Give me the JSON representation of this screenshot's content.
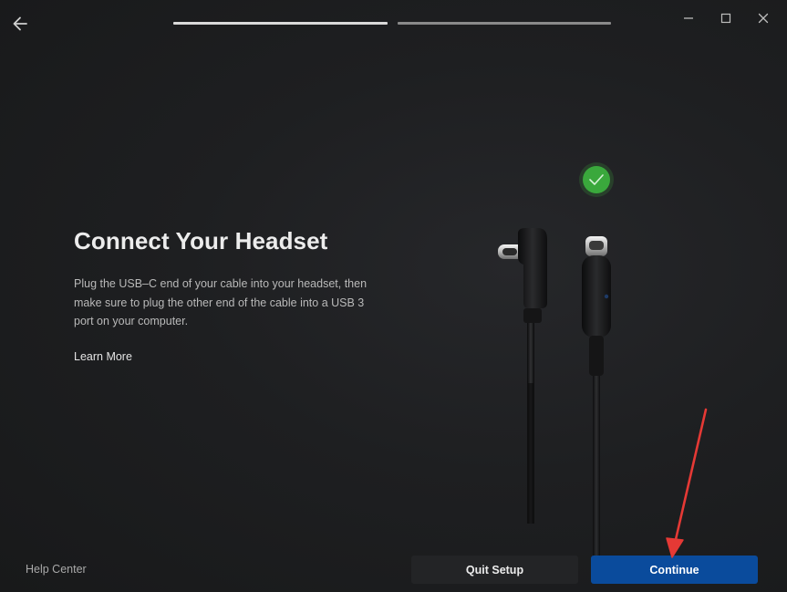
{
  "header": {
    "back_icon": "arrow-left-icon",
    "progress_steps": [
      {
        "state": "active"
      },
      {
        "state": "inactive"
      }
    ],
    "window_controls": [
      "minimize-icon",
      "maximize-icon",
      "close-icon"
    ]
  },
  "main": {
    "title": "Connect Your Headset",
    "description": "Plug the USB–C end of your cable into your headset, then make sure to plug the other end of the cable into a USB 3 port on your computer.",
    "learn_more": "Learn More",
    "illustration": {
      "status_icon": "checkmark-icon",
      "status_color": "#3aa83c",
      "cables": [
        "usb-c-right-angle-connector",
        "usb-c-straight-connector"
      ]
    }
  },
  "footer": {
    "help_center": "Help Center",
    "quit_label": "Quit Setup",
    "continue_label": "Continue"
  },
  "colors": {
    "accent": "#0a4b9c",
    "progress_active": "#d9d9d9",
    "progress_inactive": "#8a8a8a",
    "annotation": "#e53935"
  }
}
